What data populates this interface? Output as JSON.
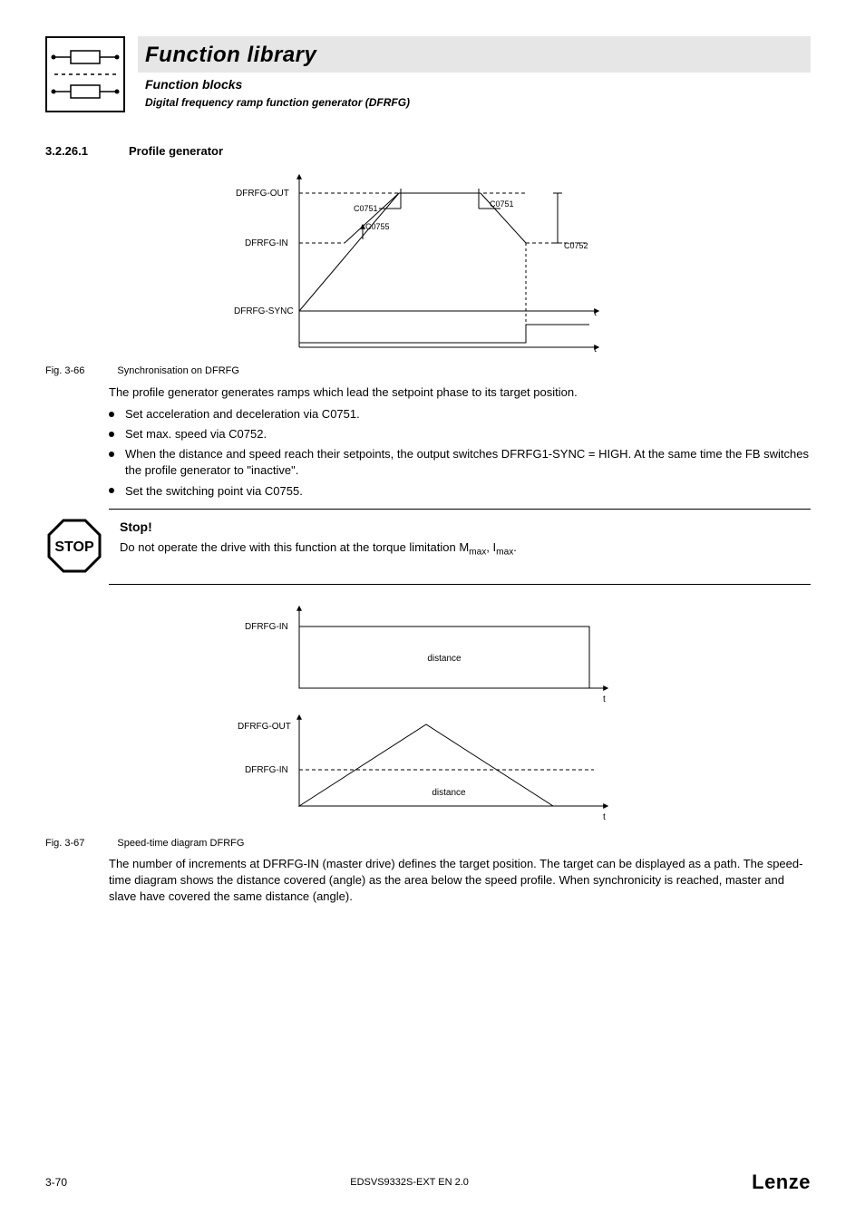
{
  "header": {
    "title": "Function library",
    "subtitle": "Function blocks",
    "subsubtitle": "Digital frequency ramp function generator (DFRFG)"
  },
  "section": {
    "number": "3.2.26.1",
    "title": "Profile generator"
  },
  "fig1": {
    "id": "Fig. 3-66",
    "caption": "Synchronisation on DFRFG",
    "labels": {
      "out": "DFRFG-OUT",
      "in": "DFRFG-IN",
      "sync": "DFRFG-SYNC",
      "c0751a": "C0751",
      "c0751b": "C0751",
      "c0755": "C0755",
      "c0752": "C0752",
      "t1": "t",
      "t2": "t"
    }
  },
  "body": {
    "intro": "The profile generator generates ramps which lead the setpoint phase to its target position.",
    "bullets": [
      "Set acceleration and deceleration via C0751.",
      "Set max. speed via C0752.",
      "When the distance and speed reach their setpoints, the output switches DFRFG1-SYNC = HIGH. At the same time the FB switches the profile generator to \"inactive\".",
      "Set the switching point via C0755."
    ]
  },
  "stop": {
    "heading": "Stop!",
    "badge": "STOP",
    "line_prefix": "Do not operate the drive with this function at the torque limitation M",
    "sub1": "max",
    "mid": ", I",
    "sub2": "max",
    "suffix": "."
  },
  "fig2": {
    "id": "Fig. 3-67",
    "caption": "Speed-time diagram DFRFG",
    "labels": {
      "in1": "DFRFG-IN",
      "out": "DFRFG-OUT",
      "in2": "DFRFG-IN",
      "dist1": "distance",
      "dist2": "distance",
      "t1": "t",
      "t2": "t"
    }
  },
  "body2": {
    "text": "The number of increments at DFRFG-IN (master drive) defines the target position. The target can be displayed as a path. The speed-time diagram shows the distance covered (angle) as the area below the speed profile. When synchronicity is reached, master and slave have covered the same distance (angle)."
  },
  "footer": {
    "page": "3-70",
    "doc": "EDSVS9332S-EXT EN 2.0",
    "brand": "Lenze"
  }
}
